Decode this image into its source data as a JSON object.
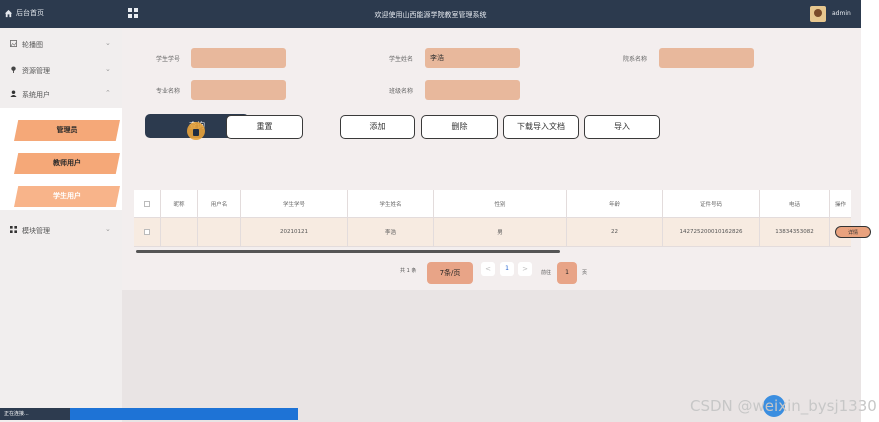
{
  "topbar": {
    "home_label": "后台首页",
    "title": "欢迎使用山西能源学院教室管理系统",
    "user": "admin"
  },
  "sidebar": {
    "items": [
      {
        "label": "轮播图",
        "icon": "image-icon",
        "chevron": "⌄"
      },
      {
        "label": "资源管理",
        "icon": "pin-icon",
        "chevron": "⌄"
      },
      {
        "label": "系统用户",
        "icon": "user-icon",
        "chevron": "⌃"
      },
      {
        "label": "模块管理",
        "icon": "grid-icon",
        "chevron": "⌄"
      }
    ],
    "submenu": [
      {
        "label": "管理员",
        "color": "#f5a878"
      },
      {
        "label": "教师用户",
        "color": "#f5a878"
      },
      {
        "label": "学生用户",
        "color": "#f8b48a"
      }
    ]
  },
  "search": {
    "student_no_label": "学生学号",
    "student_no_value": "",
    "student_name_label": "学生姓名",
    "student_name_value": "李浩",
    "college_label": "院系名称",
    "college_value": "",
    "major_label": "专业名称",
    "major_value": "",
    "class_label": "班级名称",
    "class_value": ""
  },
  "buttons": {
    "query": "查询",
    "reset": "重置",
    "add": "添加",
    "delete": "删除",
    "download": "下载导入文档",
    "import": "导入"
  },
  "table": {
    "headers": [
      "",
      "昵称",
      "用户名",
      "学生学号",
      "学生姓名",
      "性别",
      "年龄",
      "证件号码",
      "电话",
      "操作"
    ],
    "rows": [
      {
        "nickname": "",
        "username": "",
        "student_no": "20210121",
        "name": "李浩",
        "gender": "男",
        "age": "22",
        "id_no": "142725200010162826",
        "phone": "13834353082",
        "action": "详情"
      }
    ]
  },
  "pagination": {
    "total": "共 1 条",
    "page_size": "7条/页",
    "prev": "<",
    "current": "1",
    "next": ">",
    "goto_label": "前往",
    "goto_value": "1",
    "page_suffix": "页"
  },
  "status": {
    "text": "正在连接..."
  },
  "watermark": "CSDN @weixin_bysj1330",
  "colors": {
    "accent": "#2c3a4e",
    "input": "#e8b89c",
    "row": "#f7ebe1"
  }
}
